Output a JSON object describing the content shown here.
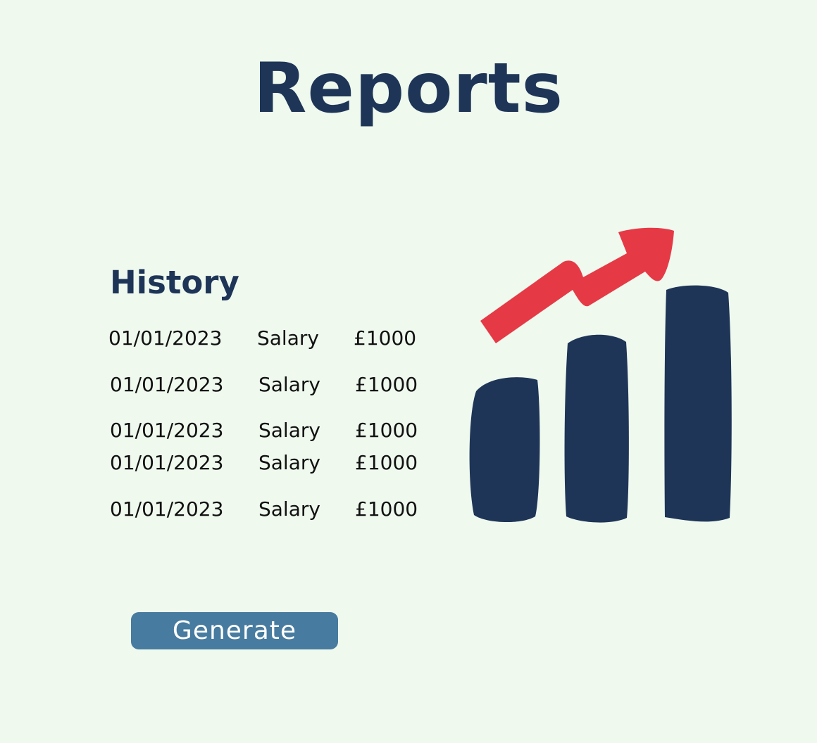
{
  "page": {
    "title": "Reports"
  },
  "history": {
    "heading": "History",
    "rows": [
      {
        "date": "01/01/2023",
        "type": "Salary",
        "amount": "£1000"
      },
      {
        "date": "01/01/2023",
        "type": "Salary",
        "amount": "£1000"
      },
      {
        "date": "01/01/2023",
        "type": "Salary",
        "amount": "£1000"
      },
      {
        "date": "01/01/2023",
        "type": "Salary",
        "amount": "£1000"
      },
      {
        "date": "01/01/2023",
        "type": "Salary",
        "amount": "£1000"
      }
    ]
  },
  "actions": {
    "generate_label": "Generate"
  },
  "illustration": {
    "icon": "bar-chart-growth-icon",
    "bar_color": "#1e3557",
    "arrow_color": "#e63946"
  },
  "colors": {
    "background": "#eff9ee",
    "heading": "#1e3557",
    "button": "#477b9f",
    "button_text": "#ffffff"
  }
}
